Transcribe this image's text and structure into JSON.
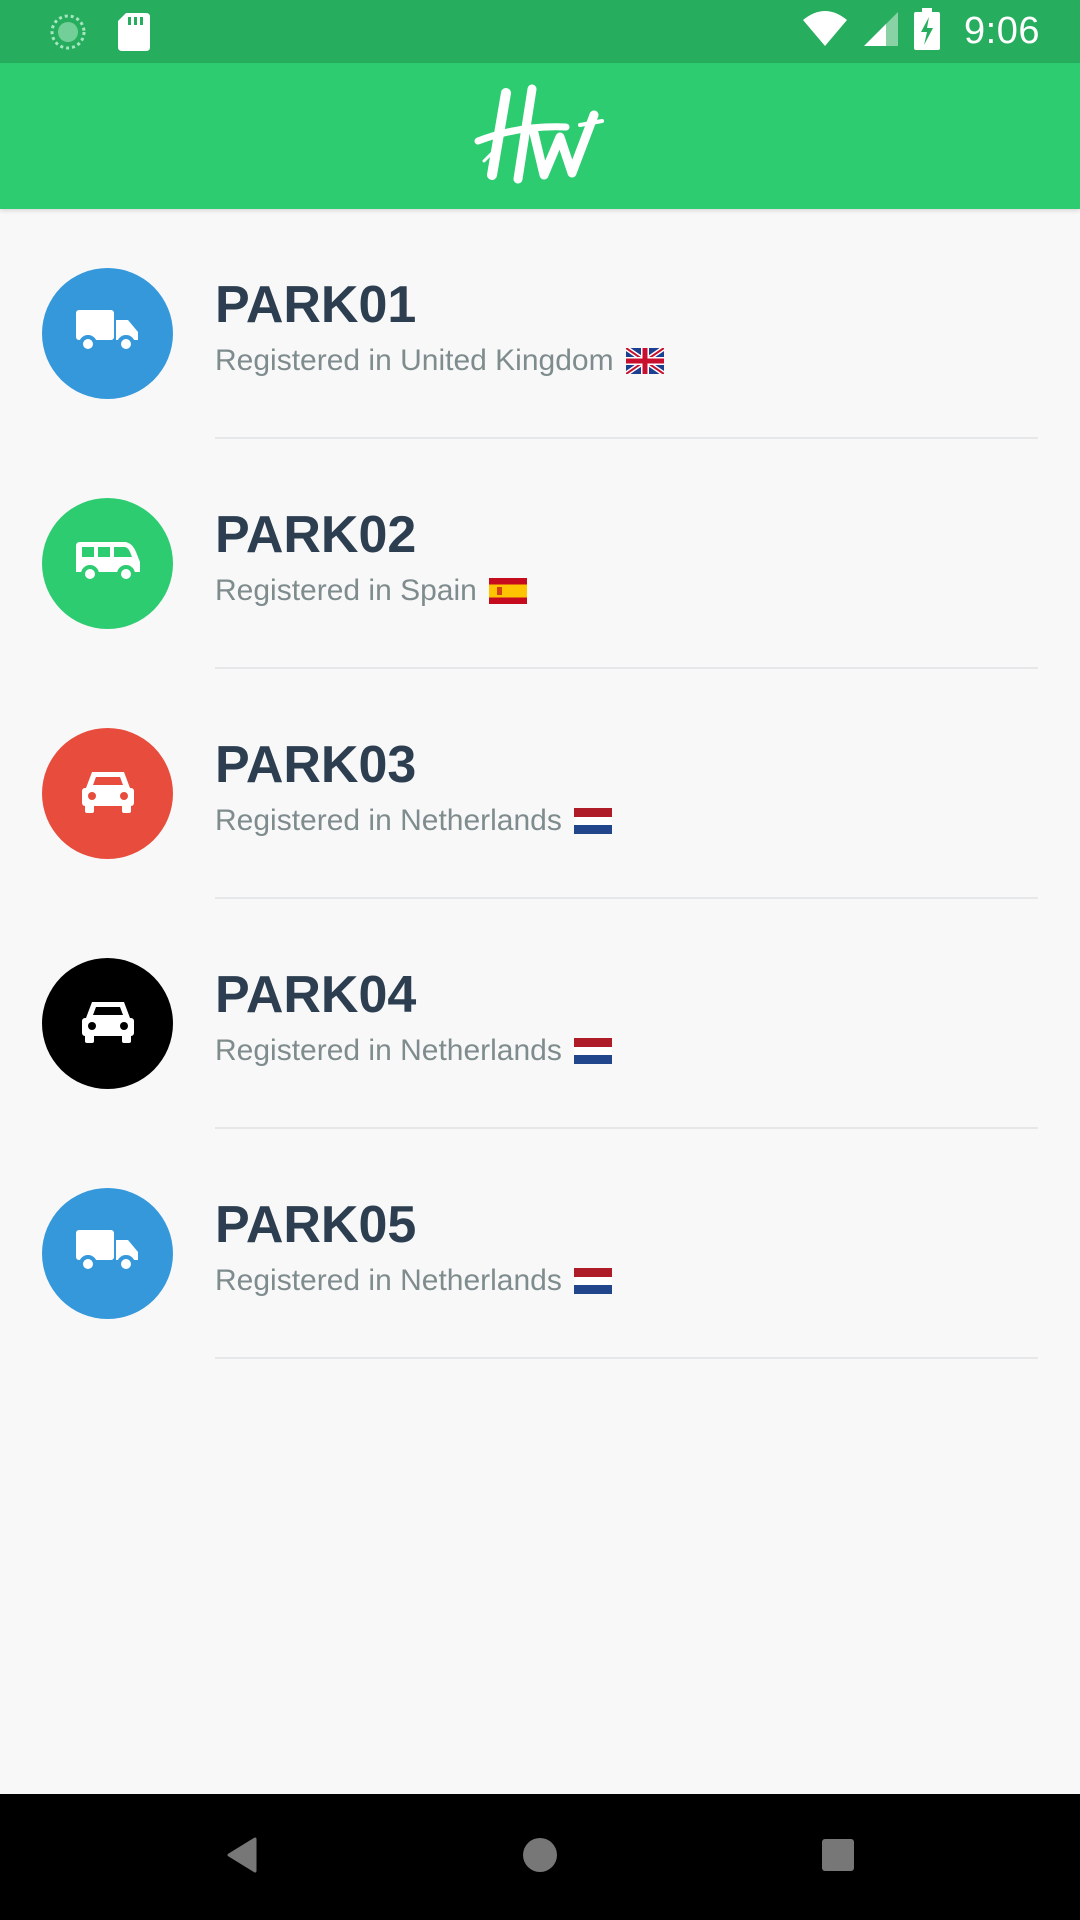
{
  "status_bar": {
    "time": "9:06",
    "left_icons": [
      "sync-icon",
      "sd-card-icon"
    ],
    "right_icons": [
      "wifi-icon",
      "signal-icon",
      "battery-charging-icon"
    ],
    "color": "#27ad5e"
  },
  "app_bar": {
    "logo": "HW",
    "color": "#2ecc71"
  },
  "vehicles": [
    {
      "name": "PARK01",
      "subtitle": "Registered in United Kingdom",
      "flag": "gb-flag-icon",
      "icon": "truck-icon",
      "color": "#3498db"
    },
    {
      "name": "PARK02",
      "subtitle": "Registered in Spain",
      "flag": "es-flag-icon",
      "icon": "van-icon",
      "color": "#2ecc71"
    },
    {
      "name": "PARK03",
      "subtitle": "Registered in Netherlands",
      "flag": "nl-flag-icon",
      "icon": "car-icon",
      "color": "#e74c3c"
    },
    {
      "name": "PARK04",
      "subtitle": "Registered in Netherlands",
      "flag": "nl-flag-icon",
      "icon": "car-icon",
      "color": "#000000"
    },
    {
      "name": "PARK05",
      "subtitle": "Registered in Netherlands",
      "flag": "nl-flag-icon",
      "icon": "truck-icon",
      "color": "#3498db"
    }
  ],
  "nav_bar": {
    "buttons": [
      "back-icon",
      "home-icon",
      "recents-icon"
    ]
  }
}
